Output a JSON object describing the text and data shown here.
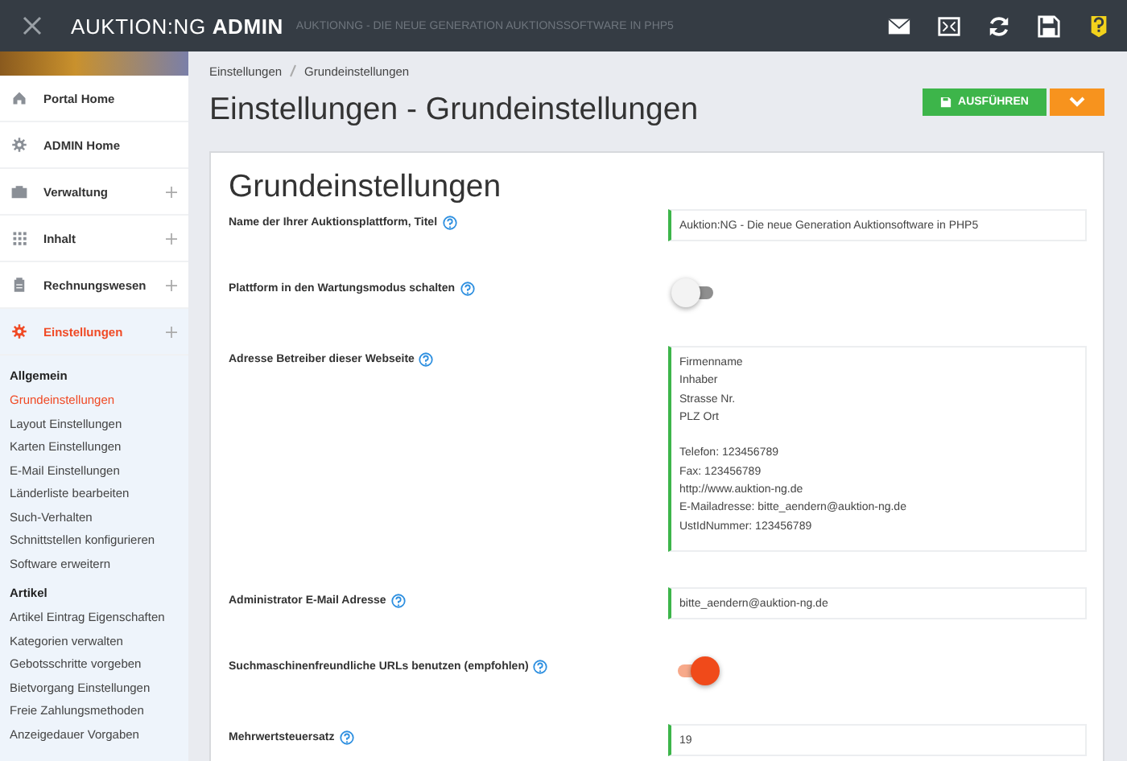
{
  "topbar": {
    "brand_light": "AUKTION:NG",
    "brand_bold": "ADMIN",
    "subtitle": "AUKTIONNG - DIE NEUE GENERATION AUKTIONSSOFTWARE IN PHP5"
  },
  "sidebar": {
    "items": [
      {
        "label": "Portal Home",
        "expandable": false,
        "selected": false
      },
      {
        "label": "ADMIN Home",
        "expandable": false,
        "selected": false
      },
      {
        "label": "Verwaltung",
        "expandable": true,
        "selected": false
      },
      {
        "label": "Inhalt",
        "expandable": true,
        "selected": false
      },
      {
        "label": "Rechnungswesen",
        "expandable": true,
        "selected": false
      },
      {
        "label": "Einstellungen",
        "expandable": true,
        "selected": true
      }
    ],
    "groups": [
      {
        "title": "Allgemein",
        "items": [
          {
            "label": "Grundeinstellungen",
            "selected": true
          },
          {
            "label": "Layout Einstellungen",
            "selected": false
          },
          {
            "label": "Karten Einstellungen",
            "selected": false
          },
          {
            "label": "E-Mail Einstellungen",
            "selected": false
          },
          {
            "label": "Länderliste bearbeiten",
            "selected": false
          },
          {
            "label": "Such-Verhalten",
            "selected": false
          },
          {
            "label": "Schnittstellen konfigurieren",
            "selected": false
          },
          {
            "label": "Software erweitern",
            "selected": false
          }
        ]
      },
      {
        "title": "Artikel",
        "items": [
          {
            "label": "Artikel Eintrag Eigenschaften",
            "selected": false
          },
          {
            "label": "Kategorien verwalten",
            "selected": false
          },
          {
            "label": "Gebotsschritte vorgeben",
            "selected": false
          },
          {
            "label": "Bietvorgang Einstellungen",
            "selected": false
          },
          {
            "label": "Freie Zahlungsmethoden",
            "selected": false
          },
          {
            "label": "Anzeigedauer Vorgaben",
            "selected": false
          }
        ]
      }
    ]
  },
  "breadcrumb": [
    "Einstellungen",
    "Grundeinstellungen"
  ],
  "page_title": "Einstellungen - Grundeinstellungen",
  "run_button": "AUSFÜHREN",
  "card": {
    "title": "Grundeinstellungen",
    "fields": [
      {
        "kind": "text",
        "label": "Name der Ihrer Auktionsplattform, Titel",
        "value": "Auktion:NG - Die neue Generation Auktionsoftware in PHP5"
      },
      {
        "kind": "toggle",
        "label": "Plattform in den Wartungsmodus schalten",
        "on": false
      },
      {
        "kind": "textarea",
        "label": "Adresse Betreiber dieser Webseite",
        "value": "Firmenname\nInhaber\nStrasse Nr.\nPLZ Ort\n\nTelefon: 123456789\nFax: 123456789\nhttp://www.auktion-ng.de\nE-Mailadresse: bitte_aendern@auktion-ng.de\nUstIdNummer: 123456789"
      },
      {
        "kind": "text",
        "label": "Administrator E-Mail Adresse",
        "value": "bitte_aendern@auktion-ng.de"
      },
      {
        "kind": "toggle",
        "label": "Suchmaschinenfreundliche URLs benutzen (empfohlen)",
        "on": true
      },
      {
        "kind": "text",
        "label": "Mehrwertsteuersatz",
        "value": "19"
      }
    ]
  }
}
